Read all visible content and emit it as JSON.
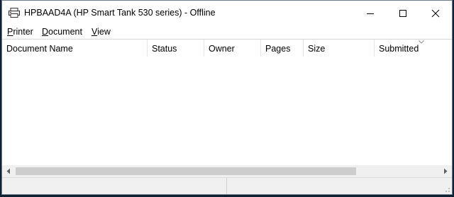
{
  "window": {
    "title": "HPBAAD4A (HP Smart Tank 530 series) - Offline",
    "icon": "printer-icon"
  },
  "caption_buttons": [
    "minimize-icon",
    "maximize-icon",
    "close-icon"
  ],
  "menu": {
    "printer": {
      "accel": "P",
      "rest": "rinter"
    },
    "document": {
      "accel": "D",
      "rest": "ocument"
    },
    "view": {
      "accel": "V",
      "rest": "iew"
    }
  },
  "columns": [
    "Document Name",
    "Status",
    "Owner",
    "Pages",
    "Size",
    "Submitted"
  ],
  "sort_indicator": "chevron-down-icon",
  "rows": [],
  "status": {
    "left": "",
    "right": ""
  },
  "colors": {
    "desktop": "#0f2233",
    "scroll_thumb": "#cdcdcd"
  }
}
